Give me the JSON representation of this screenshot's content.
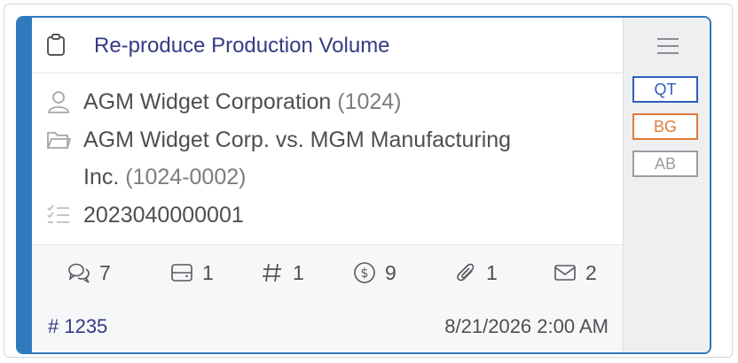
{
  "card": {
    "title": "Re-produce Production Volume",
    "client": "AGM Widget Corporation",
    "client_id": "(1024)",
    "matter_line1": "AGM Widget Corp. vs. MGM Manufacturing",
    "matter_line2": "Inc.",
    "matter_id": "(1024-0002)",
    "number": "2023040000001",
    "stats": {
      "comments": "7",
      "cards": "1",
      "tags": "1",
      "billing": "9",
      "attachments": "1",
      "messages": "2"
    },
    "case_number": "# 1235",
    "due_date": "8/21/2026 2:00 AM"
  },
  "side_tags": [
    {
      "label": "QT",
      "color": "#2b5fbf"
    },
    {
      "label": "BG",
      "color": "#e07a3a"
    },
    {
      "label": "AB",
      "color": "#9a9da1"
    }
  ],
  "colors": {
    "accent": "#2f79bd",
    "title": "#343a85"
  },
  "icons": [
    "clipboard-icon",
    "user-icon",
    "folder-icon",
    "checklist-icon",
    "comments-icon",
    "card-icon",
    "hash-icon",
    "dollar-icon",
    "paperclip-icon",
    "envelope-icon",
    "menu-icon"
  ]
}
